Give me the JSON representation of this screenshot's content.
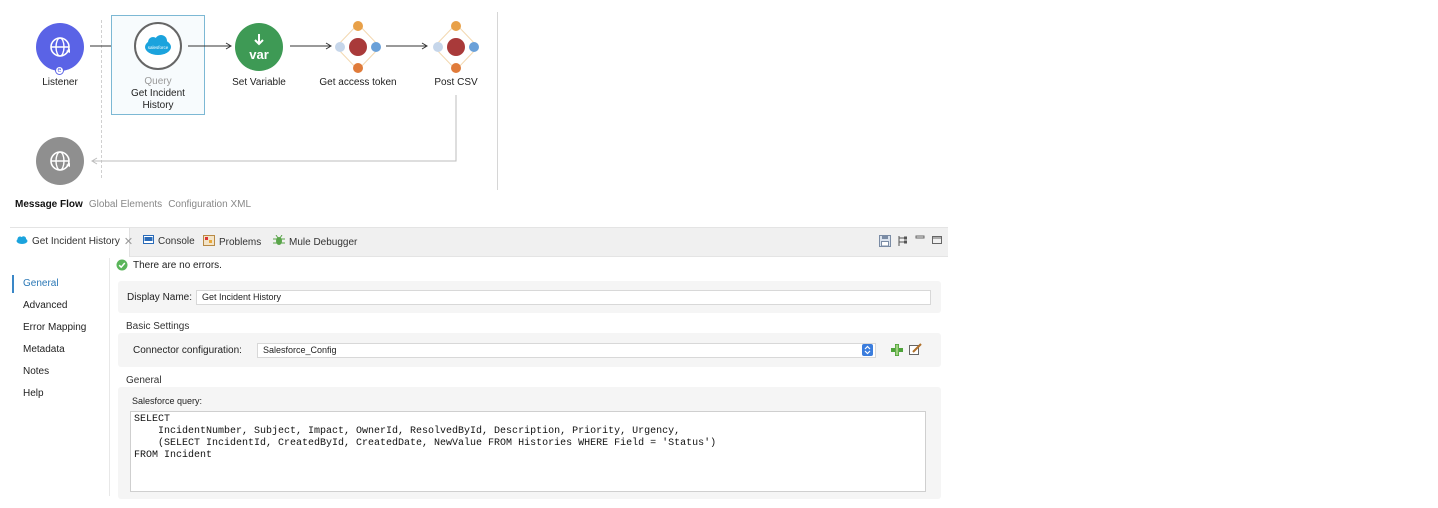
{
  "flow": {
    "nodes": [
      {
        "label": "Listener",
        "sub": ""
      },
      {
        "label": "Get Incident History",
        "sub": "Query"
      },
      {
        "label": "Set Variable",
        "sub": "",
        "icon_text": "var"
      },
      {
        "label": "Get access token",
        "sub": ""
      },
      {
        "label": "Post CSV",
        "sub": ""
      }
    ],
    "salesforce_badge": "salesforce"
  },
  "editor_tabs": {
    "message_flow": "Message Flow",
    "global_elements": "Global Elements",
    "configuration_xml": "Configuration XML"
  },
  "panel_tabs": {
    "active": "Get Incident History",
    "console": "Console",
    "problems": "Problems",
    "debugger": "Mule Debugger"
  },
  "nav": {
    "items": [
      "General",
      "Advanced",
      "Error Mapping",
      "Metadata",
      "Notes",
      "Help"
    ]
  },
  "status": {
    "message": "There are no errors."
  },
  "form": {
    "display_name_label": "Display Name:",
    "display_name_value": "Get Incident History",
    "basic_settings_title": "Basic Settings",
    "connector_label": "Connector configuration:",
    "connector_value": "Salesforce_Config",
    "general_title": "General",
    "query_label": "Salesforce query:",
    "query_value": "SELECT\n    IncidentNumber, Subject, Impact, OwnerId, ResolvedById, Description, Priority, Urgency,\n    (SELECT IncidentId, CreatedById, CreatedDate, NewValue FROM Histories WHERE Field = 'Status')\nFROM Incident"
  },
  "colors": {
    "listener": "#5a63e6",
    "setvar": "#3e9a55",
    "router_center": "#a93a3a",
    "router_top": "#e8a048",
    "router_side": "#a8c4e4",
    "disabled": "#8f8f8f",
    "accent": "#2b78b6"
  }
}
